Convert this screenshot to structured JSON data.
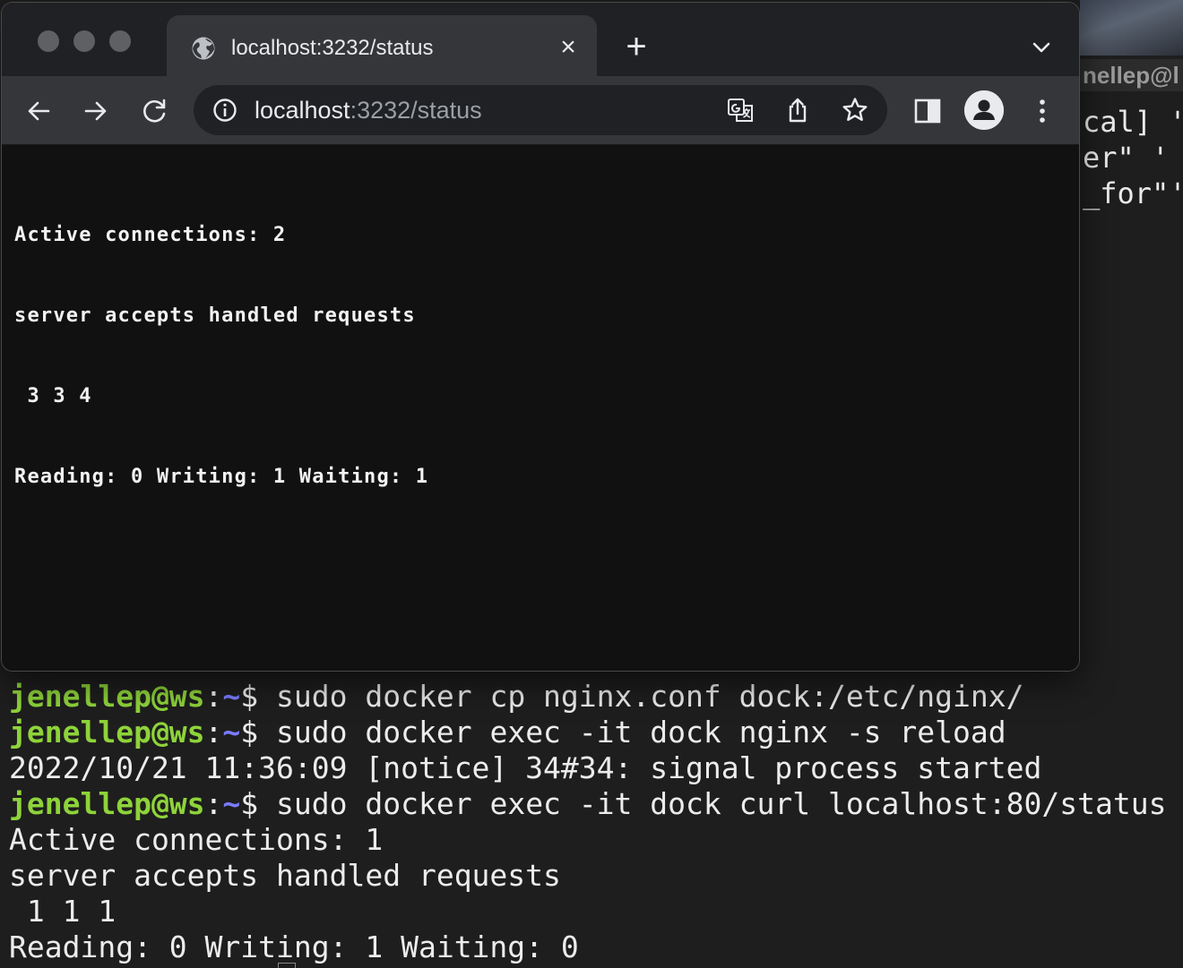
{
  "browser": {
    "tab": {
      "title": "localhost:3232/status"
    },
    "address_bar": {
      "host": "localhost",
      "path": ":3232/status"
    },
    "page": {
      "lines": [
        "Active connections: 2",
        "server accepts handled requests",
        " 3 3 4",
        "Reading: 0 Writing: 1 Waiting: 1"
      ]
    }
  },
  "terminal": {
    "title_fragment": "nellep@l",
    "right_fragments": [
      "cal] '",
      "er\" '",
      "_for\"'"
    ],
    "prompt": {
      "user_host": "jenellep@ws",
      "sep": ":",
      "dir": "~",
      "symbol": "$ "
    },
    "lines": [
      {
        "prompt": true,
        "text": "sudo docker cp nginx.conf dock:/etc/nginx/"
      },
      {
        "prompt": true,
        "text": "sudo docker exec -it dock nginx -s reload"
      },
      {
        "prompt": false,
        "text": "2022/10/21 11:36:09 [notice] 34#34: signal process started"
      },
      {
        "prompt": true,
        "text": "sudo docker exec -it dock curl localhost:80/status"
      },
      {
        "prompt": false,
        "text": "Active connections: 1"
      },
      {
        "prompt": false,
        "text": "server accepts handled requests"
      },
      {
        "prompt": false,
        "text": " 1 1 1"
      },
      {
        "prompt": false,
        "text": "Reading: 0 Writing: 1 Waiting: 0"
      }
    ]
  },
  "icons": {
    "tab_favicon": "globe-icon",
    "tab_close": "close-icon",
    "new_tab": "plus-icon",
    "tab_search": "chevron-down-icon",
    "back": "arrow-left-icon",
    "forward": "arrow-right-icon",
    "reload": "reload-icon",
    "site_info": "info-icon",
    "translate": "translate-icon",
    "share": "share-icon",
    "bookmark": "star-icon",
    "side_panel": "side-panel-icon",
    "profile": "profile-icon",
    "menu": "kebab-menu-icon"
  },
  "colors": {
    "prompt_user": "#8ed33a",
    "prompt_dir": "#7a7cff",
    "terminal_bg": "#1e1e1e",
    "browser_content_bg": "#111111",
    "toolbar_bg": "#35363a",
    "tabstrip_bg": "#202124"
  },
  "tab_close_glyph": "×",
  "new_tab_glyph": "+"
}
